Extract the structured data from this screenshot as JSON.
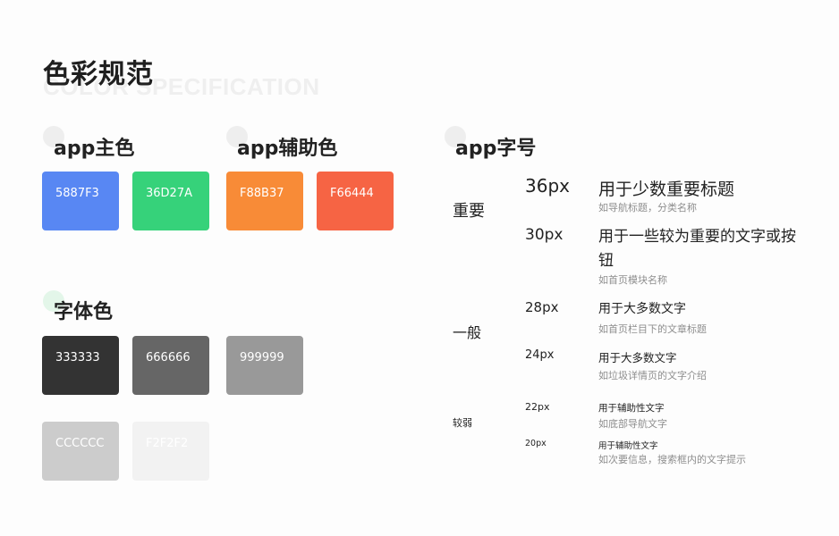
{
  "page": {
    "title": "色彩规范",
    "subtitle": "COLOR SPECIFICATION"
  },
  "primary": {
    "title": "app主色",
    "swatches": [
      {
        "label": "5887F3",
        "color": "#5887F3"
      },
      {
        "label": "36D27A",
        "color": "#36D27A"
      }
    ]
  },
  "secondary": {
    "title": "app辅助色",
    "swatches": [
      {
        "label": "F88B37",
        "color": "#F88B37"
      },
      {
        "label": "F66444",
        "color": "#F66444"
      }
    ]
  },
  "font_colors": {
    "title": "字体色",
    "swatches": [
      {
        "label": "333333",
        "color": "#333333"
      },
      {
        "label": "666666",
        "color": "#666666"
      },
      {
        "label": "999999",
        "color": "#999999"
      },
      {
        "label": "CCCCCC",
        "color": "#CCCCCC"
      },
      {
        "label": "F2F2F2",
        "color": "#F2F2F2"
      }
    ]
  },
  "font_sizes": {
    "title": "app字号",
    "groups": {
      "important": "重要",
      "normal": "一般",
      "weak": "较弱"
    },
    "rows": [
      {
        "size": "36px",
        "usage": "用于少数重要标题",
        "example": "如导航标题，分类名称"
      },
      {
        "size": "30px",
        "usage": "用于一些较为重要的文字或按钮",
        "example": "如首页模块名称"
      },
      {
        "size": "28px",
        "usage": "用于大多数文字",
        "example": "如首页栏目下的文章标题"
      },
      {
        "size": "24px",
        "usage": "用于大多数文字",
        "example": "如垃圾详情页的文字介绍"
      },
      {
        "size": "22px",
        "usage": "用于辅助性文字",
        "example": "如底部导航文字"
      },
      {
        "size": "20px",
        "usage": "用于辅助性文字",
        "example": "如次要信息，搜索框内的文字提示"
      }
    ]
  }
}
